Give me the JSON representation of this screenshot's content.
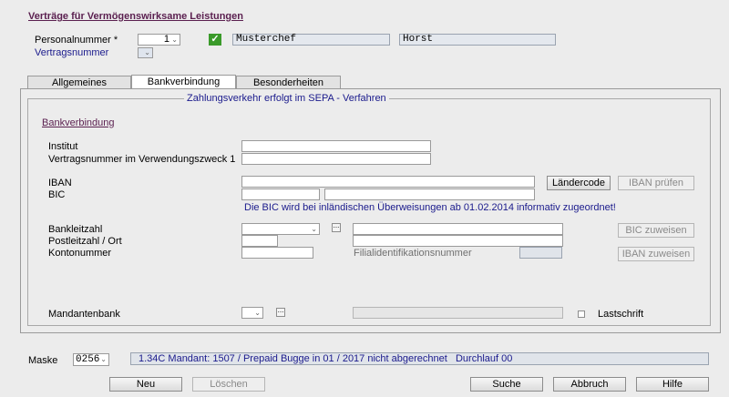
{
  "title": "Verträge für Vermögenswirksame Leistungen",
  "header": {
    "personalnummer_label": "Personalnummer *",
    "personalnummer_value": "1",
    "vertragsnummer_label": "Vertragsnummer",
    "name1": "Musterchef",
    "name2": "Horst",
    "check_color": "#3a9a2a"
  },
  "tabs": [
    "Allgemeines",
    "Bankverbindung",
    "Besonderheiten"
  ],
  "active_tab": "Bankverbindung",
  "panel": {
    "group_title": "Zahlungsverkehr erfolgt im SEPA - Verfahren",
    "section_title": "Bankverbindung",
    "institut_label": "Institut",
    "vertragsnummer_vz_label": "Vertragsnummer im Verwendungszweck 1",
    "iban_label": "IBAN",
    "bic_label": "BIC",
    "laendercode_button": "Ländercode",
    "iban_pruefen_button": "IBAN prüfen",
    "bic_note": "Die BIC wird bei inländischen Überweisungen ab 01.02.2014 informativ zugeordnet!",
    "bankleitzahl_label": "Bankleitzahl",
    "plz_ort_label": "Postleitzahl / Ort",
    "kontonummer_label": "Kontonummer",
    "filial_label": "Filialidentifikationsnummer",
    "bic_zuweisen_button": "BIC zuweisen",
    "iban_zuweisen_button": "IBAN zuweisen",
    "mandantenbank_label": "Mandantenbank",
    "lastschrift_label": "Lastschrift",
    "ellipsis": "..."
  },
  "footer": {
    "maske_label": "Maske",
    "maske_value": "0256",
    "status": "1.34C Mandant: 1507 / Prepaid Bugge in 01 / 2017 nicht abgerechnet   Durchlauf 00",
    "neu": "Neu",
    "loeschen": "Löschen",
    "suche": "Suche",
    "abbruch": "Abbruch",
    "hilfe": "Hilfe"
  }
}
